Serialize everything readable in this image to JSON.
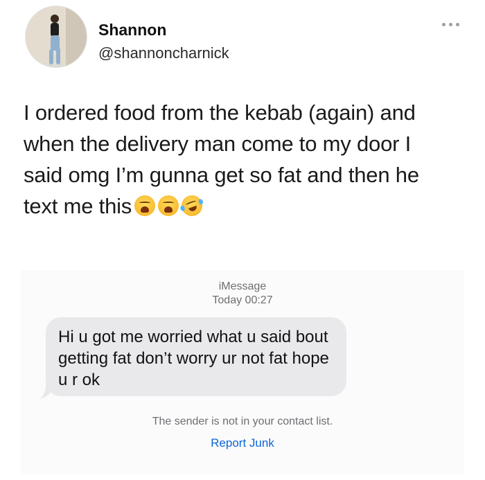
{
  "tweet": {
    "author": {
      "display_name": "Shannon",
      "handle": "@shannoncharnick",
      "avatar_icon": "profile-photo"
    },
    "more_icon": "ellipsis-icon",
    "text": "I ordered food from the kebab (again) and when the delivery man come to my door I said omg I’m gunna get so fat and then he text me this",
    "emojis": [
      "weary-face",
      "weary-face",
      "rolling-on-floor-laughing"
    ]
  },
  "imessage": {
    "service_label": "iMessage",
    "timestamp": "Today 00:27",
    "incoming_message": "Hi u got me worried what u said bout getting fat don’t worry ur not fat hope u r ok",
    "bubble_color": "#e9e9eb",
    "notice": "The sender is not in your contact list.",
    "report_link": "Report Junk",
    "link_color": "#0a66d8"
  }
}
